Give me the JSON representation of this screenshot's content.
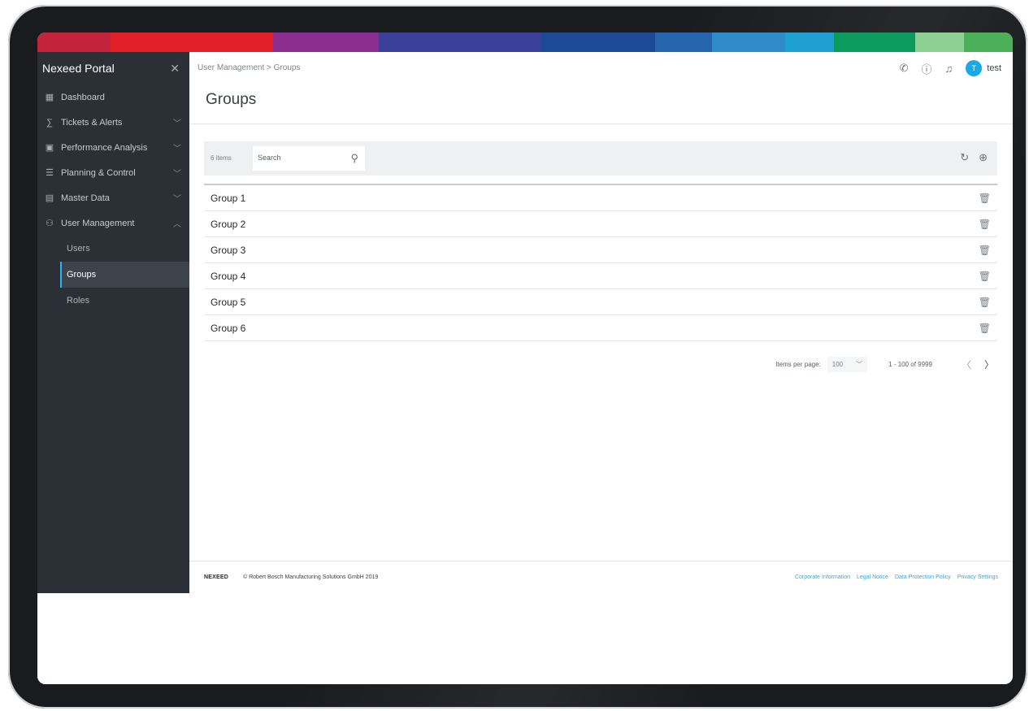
{
  "colors": {
    "sidebar_bg": "#2b3036",
    "accent": "#19a9e8",
    "link": "#3fa6d6",
    "supergraphic": [
      "#c3243b",
      "#e2202a",
      "#8b2e8f",
      "#3a3f9a",
      "#1d4a95",
      "#2565ae",
      "#2f8bca",
      "#1fa0d2",
      "#0d9a5d",
      "#8ecf94",
      "#4cb05b"
    ]
  },
  "sidebar": {
    "title": "Nexeed Portal",
    "close_icon": "close-icon",
    "items": [
      {
        "label": "Dashboard",
        "icon": "dashboard-icon"
      },
      {
        "label": "Tickets & Alerts",
        "icon": "tickets-icon",
        "expandable": true
      },
      {
        "label": "Performance Analysis",
        "icon": "performance-icon",
        "expandable": true
      },
      {
        "label": "Planning & Control",
        "icon": "planning-icon",
        "expandable": true
      },
      {
        "label": "Master Data",
        "icon": "master-data-icon",
        "expandable": true
      },
      {
        "label": "User Management",
        "icon": "user-management-icon",
        "expandable": true,
        "expanded": true
      }
    ],
    "subitems": [
      {
        "label": "Users"
      },
      {
        "label": "Groups",
        "active": true
      },
      {
        "label": "Roles"
      }
    ]
  },
  "header": {
    "breadcrumb": [
      "User Management",
      "Groups"
    ],
    "breadcrumb_separator": ">",
    "user_initial": "T",
    "username": "test"
  },
  "main": {
    "title": "Groups",
    "item_count": "6 items",
    "search_placeholder": "Search",
    "groups": [
      "Group 1",
      "Group 2",
      "Group 3",
      "Group 4",
      "Group 5",
      "Group 6"
    ]
  },
  "pagination": {
    "items_per_page_label": "Items per page:",
    "items_per_page": "100",
    "range": "1 - 100 of 9999"
  },
  "footer": {
    "brand": "NEXEED",
    "copyright": "© Robert Bosch Manufacturing Solutions GmbH 2019",
    "links": [
      "Corporate Information",
      "Legal Notice",
      "Data Protection Policy",
      "Privacy Settings"
    ]
  }
}
